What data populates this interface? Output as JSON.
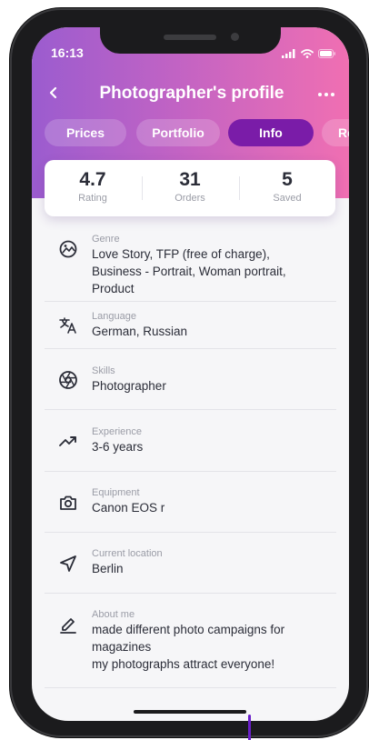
{
  "status_bar": {
    "time": "16:13"
  },
  "header": {
    "title": "Photographer's profile"
  },
  "tabs": [
    {
      "label": "Prices"
    },
    {
      "label": "Portfolio"
    },
    {
      "label": "Info"
    },
    {
      "label": "Re"
    }
  ],
  "active_tab": "Info",
  "stats": [
    {
      "value": "4.7",
      "label": "Rating"
    },
    {
      "value": "31",
      "label": "Orders"
    },
    {
      "value": "5",
      "label": "Saved"
    }
  ],
  "info": [
    {
      "label": "Genre",
      "value": [
        "Love Story, TFP (free of charge),",
        "Business - Portrait, Woman portrait,",
        "Product"
      ],
      "icon": "palette-icon"
    },
    {
      "label": "Language",
      "value": [
        "German, Russian"
      ],
      "icon": "translate-icon"
    },
    {
      "label": "Skills",
      "value": [
        "Photographer"
      ],
      "icon": "aperture-icon"
    },
    {
      "label": "Experience",
      "value": [
        "3-6 years"
      ],
      "icon": "trending-up-icon"
    },
    {
      "label": "Equipment",
      "value": [
        "Canon EOS r"
      ],
      "icon": "camera-icon"
    },
    {
      "label": "Current location",
      "value": [
        "Berlin"
      ],
      "icon": "navigation-icon"
    },
    {
      "label": "About me",
      "value": [
        "made different photo campaigns for",
        "magazines",
        "my photographs attract everyone!"
      ],
      "icon": "edit-icon"
    }
  ],
  "colors": {
    "gradient_start": "#9b5ccf",
    "gradient_end": "#f06fb2",
    "active_tab": "#7a1ca8",
    "text": "#2b2d38",
    "muted": "#9a9ca6"
  }
}
